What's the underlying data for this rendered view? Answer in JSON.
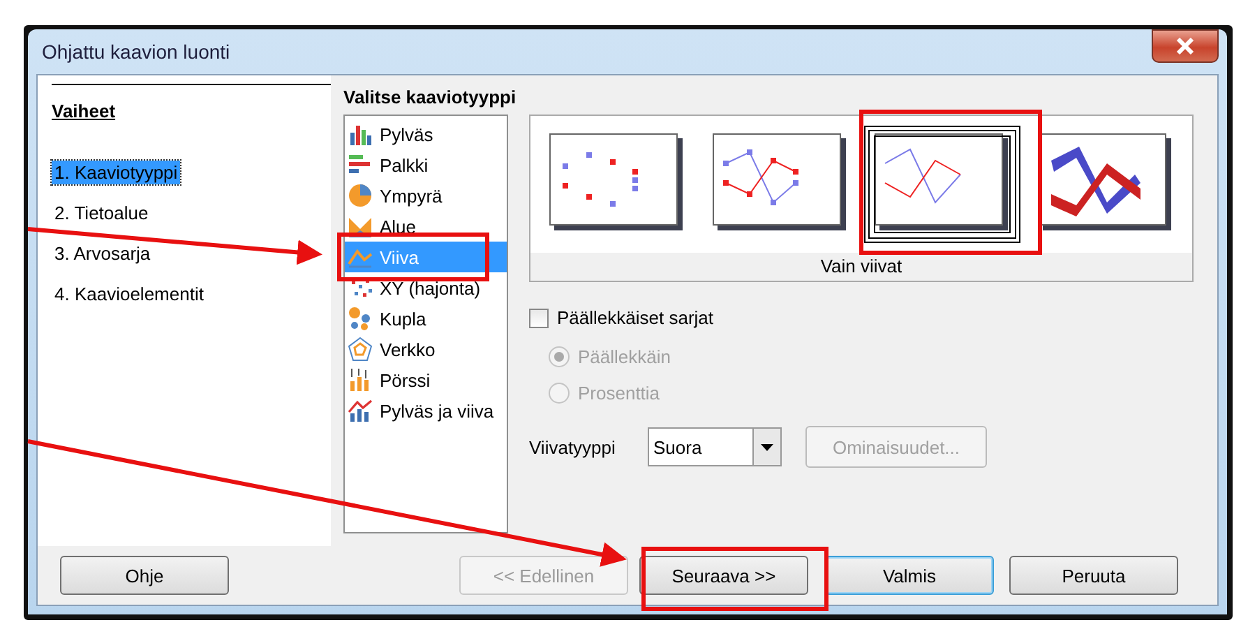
{
  "window": {
    "title": "Ohjattu kaavion luonti"
  },
  "steps": {
    "title": "Vaiheet",
    "items": [
      {
        "label": "1. Kaaviotyyppi",
        "selected": true
      },
      {
        "label": "2. Tietoalue",
        "selected": false
      },
      {
        "label": "3. Arvosarja",
        "selected": false
      },
      {
        "label": "4. Kaavioelementit",
        "selected": false
      }
    ]
  },
  "chart_type": {
    "title": "Valitse kaaviotyyppi",
    "types": [
      {
        "label": "Pylväs",
        "kind": "column",
        "selected": false
      },
      {
        "label": "Palkki",
        "kind": "bar",
        "selected": false
      },
      {
        "label": "Ympyrä",
        "kind": "pie",
        "selected": false
      },
      {
        "label": "Alue",
        "kind": "area",
        "selected": false
      },
      {
        "label": "Viiva",
        "kind": "line",
        "selected": true
      },
      {
        "label": "XY (hajonta)",
        "kind": "xy",
        "selected": false
      },
      {
        "label": "Kupla",
        "kind": "bubble",
        "selected": false
      },
      {
        "label": "Verkko",
        "kind": "net",
        "selected": false
      },
      {
        "label": "Pörssi",
        "kind": "stock",
        "selected": false
      },
      {
        "label": "Pylväs ja viiva",
        "kind": "column-line",
        "selected": false
      }
    ],
    "variants": [
      {
        "kind": "points",
        "selected": false
      },
      {
        "kind": "points-lines",
        "selected": false
      },
      {
        "kind": "lines",
        "selected": true
      },
      {
        "kind": "ribbon",
        "selected": false
      }
    ],
    "variant_caption": "Vain viivat",
    "stacked": {
      "label": "Päällekkäiset sarjat",
      "checked": false
    },
    "stack_modes": [
      {
        "label": "Päällekkäin",
        "selected": true,
        "disabled": true
      },
      {
        "label": "Prosenttia",
        "selected": false,
        "disabled": true
      }
    ],
    "line_type": {
      "label": "Viivatyyppi",
      "value": "Suora"
    },
    "properties_button": {
      "label": "Ominaisuudet...",
      "disabled": true
    }
  },
  "buttons": [
    {
      "label": "Ohje",
      "disabled": false,
      "default": false
    },
    {
      "label": "<< Edellinen",
      "disabled": true,
      "default": false
    },
    {
      "label": "Seuraava >>",
      "disabled": false,
      "default": false
    },
    {
      "label": "Valmis",
      "disabled": false,
      "default": true
    },
    {
      "label": "Peruuta",
      "disabled": false,
      "default": false
    }
  ]
}
